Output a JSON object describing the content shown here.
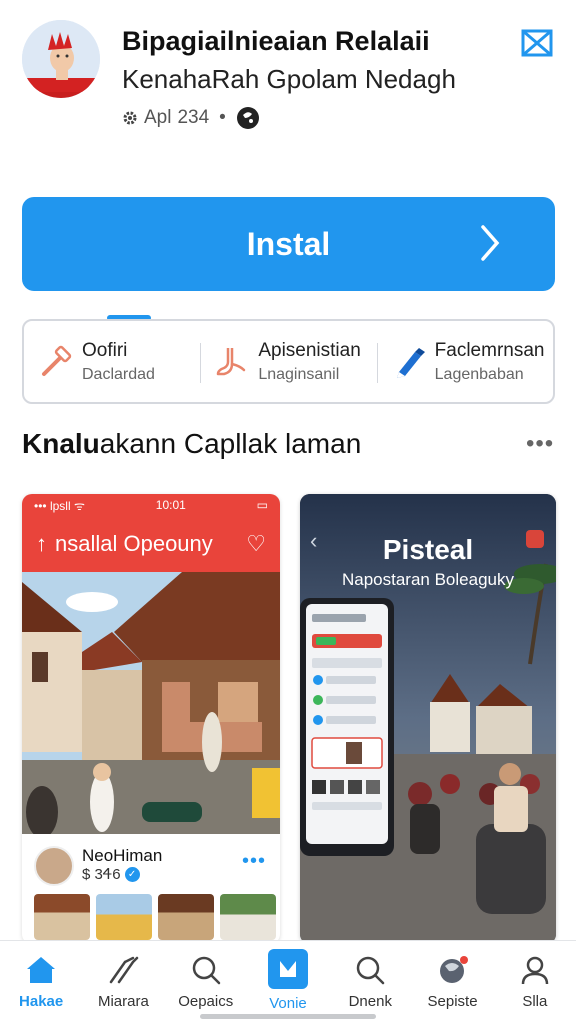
{
  "header": {
    "title": "Bipagiailnieaian Relalaii",
    "subtitle": "KenahaRah Gpolam Nedagh",
    "meta_label": "Apl",
    "meta_count": "234",
    "meta_sep": "•"
  },
  "install": {
    "label": "Instal"
  },
  "info_items": [
    {
      "top": "Oofiri",
      "bottom": "Daclardad",
      "icon": "hammer-icon"
    },
    {
      "top": "Apisenistian",
      "bottom": "Lnaginsanil",
      "icon": "foot-icon"
    },
    {
      "top": "Faclemrnsan",
      "bottom": "Lagenbaban",
      "icon": "pen-icon"
    }
  ],
  "section": {
    "title_bold": "Knalu",
    "title_rest": "akann Capllak laman",
    "more": "•••"
  },
  "shot1": {
    "status_left": "••• lpsll ᯤ",
    "status_center": "10:01",
    "banner": "nsallal Opeouny",
    "banner_arrow": "↑",
    "banner_heart": "♡",
    "profile_name": "NeoHiman",
    "profile_price": "$ 3Ꮞ6",
    "verified_mark": "✓",
    "dots": "•••"
  },
  "shot2": {
    "title": "Pisteal",
    "subtitle": "Napostaran Boleaguky",
    "back": "‹"
  },
  "nav": [
    {
      "label": "Hakae",
      "icon": "home-icon",
      "state": "active"
    },
    {
      "label": "Miarara",
      "icon": "tools-icon",
      "state": "normal"
    },
    {
      "label": "Oepaics",
      "icon": "search-icon",
      "state": "normal"
    },
    {
      "label": "Vonie",
      "icon": "download-box-icon",
      "state": "boxed"
    },
    {
      "label": "Dnenk",
      "icon": "search-icon",
      "state": "normal"
    },
    {
      "label": "Sepiste",
      "icon": "globe-icon",
      "state": "normal"
    },
    {
      "label": "Slla",
      "icon": "person-icon",
      "state": "normal"
    }
  ],
  "colors": {
    "accent": "#2196ee",
    "banner_red": "#e9443b"
  }
}
